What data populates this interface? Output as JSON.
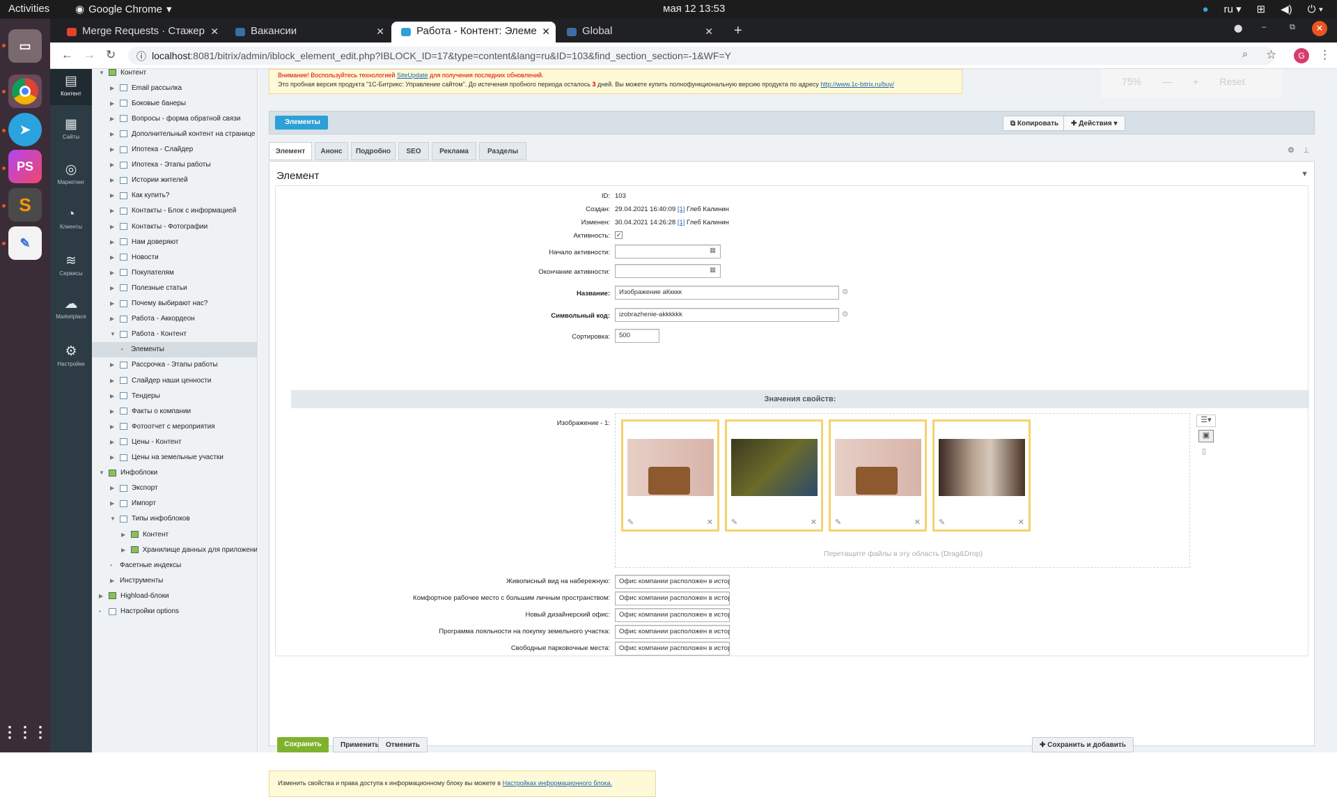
{
  "system": {
    "activities": "Activities",
    "app": "Google Chrome",
    "clock": "мая 12  13:53",
    "lang": "ru"
  },
  "browser": {
    "tabs": [
      {
        "label": "Merge Requests · Стажер"
      },
      {
        "label": "Вакансии"
      },
      {
        "label": "Работа - Контент: Элеме"
      },
      {
        "label": "Global"
      }
    ],
    "url_host": "localhost",
    "url_rest": ":8081/bitrix/admin/iblock_element_edit.php?IBLOCK_ID=17&type=content&lang=ru&ID=103&find_section_section=-1&WF=Y",
    "avatar": "G"
  },
  "left_menu": [
    {
      "label": "Контент"
    },
    {
      "label": "Сайты"
    },
    {
      "label": "Маркетинг"
    },
    {
      "label": "Клиенты"
    },
    {
      "label": "Сервисы"
    },
    {
      "label": "Marketplace"
    },
    {
      "label": "Настройки"
    }
  ],
  "tree": [
    {
      "label": "Контент",
      "lvl": 0
    },
    {
      "label": "Email рассылка",
      "lvl": 1
    },
    {
      "label": "Боковые банеры",
      "lvl": 1
    },
    {
      "label": "Вопросы - форма обратной связи",
      "lvl": 1
    },
    {
      "label": "Дополнительный контент на странице",
      "lvl": 1
    },
    {
      "label": "Ипотека - Слайдер",
      "lvl": 1
    },
    {
      "label": "Ипотека - Этапы работы",
      "lvl": 1
    },
    {
      "label": "Истории жителей",
      "lvl": 1
    },
    {
      "label": "Как купить?",
      "lvl": 1
    },
    {
      "label": "Контакты - Блок с информацией",
      "lvl": 1
    },
    {
      "label": "Контакты - Фотографии",
      "lvl": 1
    },
    {
      "label": "Нам доверяют",
      "lvl": 1
    },
    {
      "label": "Новости",
      "lvl": 1
    },
    {
      "label": "Покупателям",
      "lvl": 1
    },
    {
      "label": "Полезные статьи",
      "lvl": 1
    },
    {
      "label": "Почему выбирают нас?",
      "lvl": 1
    },
    {
      "label": "Работа - Аккордеон",
      "lvl": 1
    },
    {
      "label": "Работа - Контент",
      "lvl": 1
    },
    {
      "label": "Элементы",
      "lvl": 2
    },
    {
      "label": "Рассрочка - Этапы работы",
      "lvl": 1
    },
    {
      "label": "Слайдер наши ценности",
      "lvl": 1
    },
    {
      "label": "Тендеры",
      "lvl": 1
    },
    {
      "label": "Факты о компании",
      "lvl": 1
    },
    {
      "label": "Фотоотчет с мероприятия",
      "lvl": 1
    },
    {
      "label": "Цены - Контент",
      "lvl": 1
    },
    {
      "label": "Цены на земельные участки",
      "lvl": 1
    },
    {
      "label": "Инфоблоки",
      "lvl": 0
    },
    {
      "label": "Экспорт",
      "lvl": 1
    },
    {
      "label": "Импорт",
      "lvl": 1
    },
    {
      "label": "Типы инфоблоков",
      "lvl": 1
    },
    {
      "label": "Контент",
      "lvl": 2
    },
    {
      "label": "Хранилище данных для приложени",
      "lvl": 2
    },
    {
      "label": "Фасетные индексы",
      "lvl": 1
    },
    {
      "label": "Инструменты",
      "lvl": 1
    },
    {
      "label": "Highload-блоки",
      "lvl": 0
    },
    {
      "label": "Настройки options",
      "lvl": 0
    }
  ],
  "warning": {
    "line1": "Внимание! Воспользуйтесь технологией",
    "link1": "SiteUpdate",
    "line1b": "для получения последних обновлений.",
    "line2": "Это пробная версия продукта \"1С-Битрикс: Управление сайтом\". До истечения пробного периода осталось",
    "days": "3",
    "line2b": "дней. Вы можете купить полнофункциональную версию продукта по адресу",
    "link2": "http://www.1c-bitrix.ru/buy/"
  },
  "zoom": {
    "value": "75%",
    "minus": "—",
    "plus": "+",
    "reset": "Reset"
  },
  "toolbar": {
    "elements": "Элементы",
    "copy": "Копировать",
    "actions": "Действия"
  },
  "tabs": [
    {
      "label": "Элемент"
    },
    {
      "label": "Анонс"
    },
    {
      "label": "Подробно"
    },
    {
      "label": "SEO"
    },
    {
      "label": "Реклама"
    },
    {
      "label": "Разделы"
    }
  ],
  "panel_title": "Элемент",
  "fields": {
    "id_label": "ID:",
    "id": "103",
    "created_label": "Создан:",
    "created": "29.04.2021 16:40:09",
    "created_uid": "[1]",
    "created_user": "Глеб Калинин",
    "changed_label": "Изменен:",
    "changed": "30.04.2021 14:26:28",
    "changed_uid": "[1]",
    "changed_user": "Глеб Калинин",
    "active_label": "Активность:",
    "start_label": "Начало активности:",
    "end_label": "Окончание активности:",
    "name_label": "Название:",
    "name": "Изображение аКкккк",
    "code_label": "Символьный код:",
    "code": "izobrazhenie-akkkkkk",
    "sort_label": "Сортировка:",
    "sort": "500"
  },
  "props": {
    "header": "Значения свойств:",
    "image_label": "Изображение - 1:",
    "dragdrop": "Перетащите файлы в эту область (Drag&Drop)",
    "rows": [
      {
        "label": "Живописный вид на набережную:",
        "value": "Офис компании расположен в историчес"
      },
      {
        "label": "Комфортное рабочее место с большим личным пространством:",
        "value": "Офис компании расположен в историчес"
      },
      {
        "label": "Новый дизайнерский офис:",
        "value": "Офис компании расположен в историчес"
      },
      {
        "label": "Программа лояльности на покупку земельного участка:",
        "value": "Офис компании расположен в историчес"
      },
      {
        "label": "Свободные парковочные места:",
        "value": "Офис компании расположен в историчес"
      }
    ]
  },
  "buttons": {
    "save": "Сохранить",
    "apply": "Применить",
    "cancel": "Отменить",
    "save_add": "Сохранить и добавить"
  },
  "note": {
    "text": "Изменить свойства и права доступа к информационному блоку вы можете в",
    "link": "Настройках информационного блока."
  }
}
